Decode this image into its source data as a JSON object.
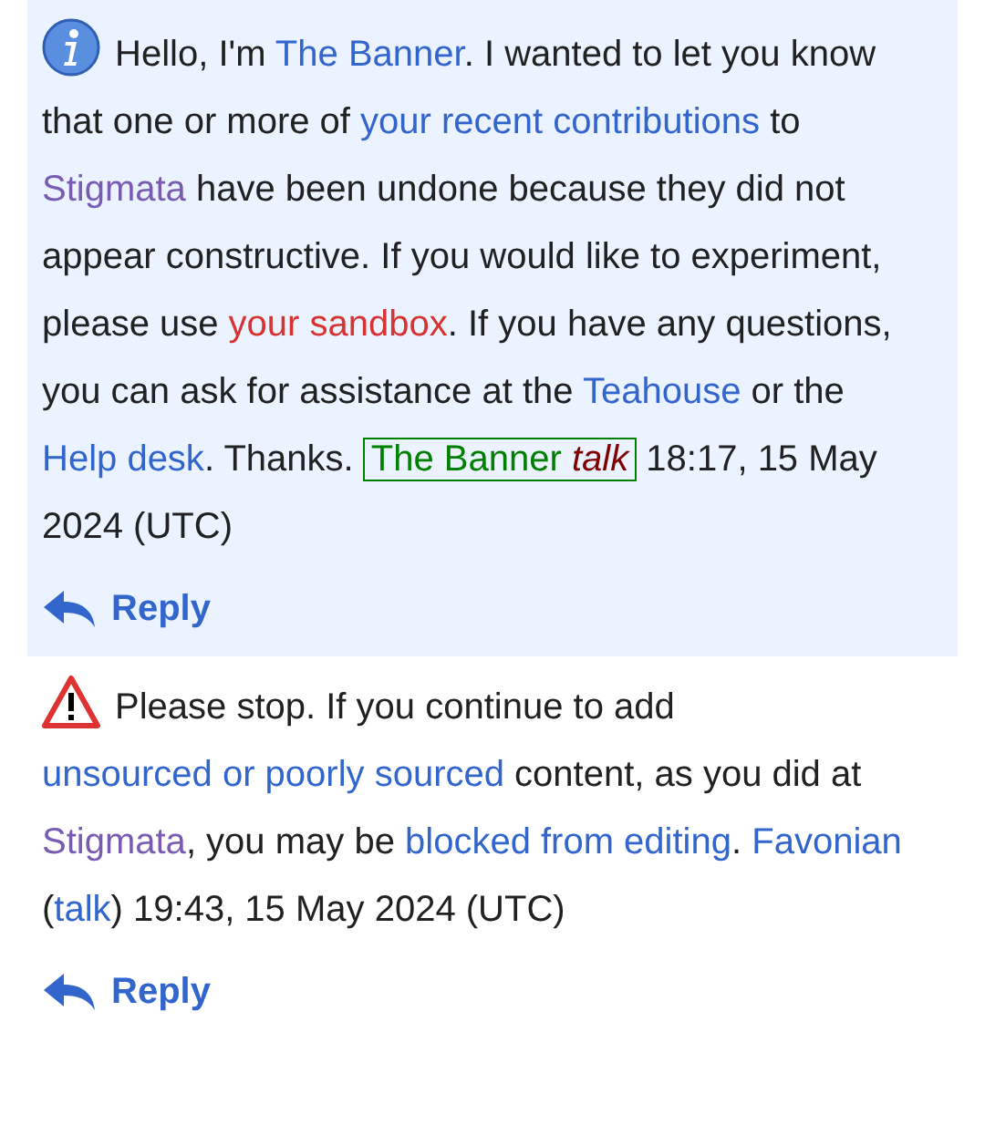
{
  "messages": [
    {
      "kind": "info",
      "highlighted": true,
      "segments": [
        {
          "kind": "text",
          "text": "Hello, I'm "
        },
        {
          "kind": "link",
          "text": "The Banner"
        },
        {
          "kind": "text",
          "text": ". I wanted to let you know that one or more of "
        },
        {
          "kind": "link",
          "text": "your recent contributions"
        },
        {
          "kind": "text",
          "text": " to "
        },
        {
          "kind": "visited",
          "text": "Stigmata"
        },
        {
          "kind": "text",
          "text": " have been undone because they did not appear constructive. If you would like to experiment, please use "
        },
        {
          "kind": "redlink",
          "text": "your sandbox"
        },
        {
          "kind": "text",
          "text": ". If you have any questions, you can ask for assistance at the "
        },
        {
          "kind": "link",
          "text": "Teahouse"
        },
        {
          "kind": "text",
          "text": " or the "
        },
        {
          "kind": "link",
          "text": "Help desk"
        },
        {
          "kind": "text",
          "text": ". Thanks. "
        },
        {
          "kind": "sigbox",
          "name": "The Banner",
          "talk": "talk"
        },
        {
          "kind": "text",
          "text": " 18:17, 15 May 2024 (UTC)"
        }
      ],
      "reply": "Reply"
    },
    {
      "kind": "warning",
      "highlighted": false,
      "segments": [
        {
          "kind": "text",
          "text": "Please stop. If you continue to add "
        },
        {
          "kind": "link",
          "text": "unsourced or poorly sourced"
        },
        {
          "kind": "text",
          "text": " content, as you did at "
        },
        {
          "kind": "visited",
          "text": "Stigmata"
        },
        {
          "kind": "text",
          "text": ", you may be "
        },
        {
          "kind": "link",
          "text": "blocked from editing"
        },
        {
          "kind": "text",
          "text": ". "
        },
        {
          "kind": "link",
          "text": "Favonian"
        },
        {
          "kind": "text",
          "text": " ("
        },
        {
          "kind": "link",
          "text": "talk"
        },
        {
          "kind": "text",
          "text": ") 19:43, 15 May 2024 (UTC)"
        }
      ],
      "reply": "Reply"
    }
  ]
}
